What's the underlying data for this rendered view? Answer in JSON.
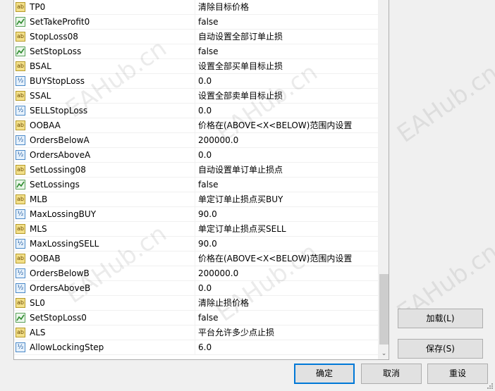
{
  "params": [
    {
      "icon": "ab-icon",
      "name": "TP0",
      "value": "清除目标价格"
    },
    {
      "icon": "bool-icon",
      "name": "SetTakeProfit0",
      "value": "false"
    },
    {
      "icon": "ab-icon",
      "name": "StopLoss08",
      "value": "自动设置全部订单止损"
    },
    {
      "icon": "bool-icon",
      "name": "SetStopLoss",
      "value": "false"
    },
    {
      "icon": "ab-icon",
      "name": "BSAL",
      "value": "设置全部买单目标止损"
    },
    {
      "icon": "value-icon",
      "name": "BUYStopLoss",
      "value": "0.0"
    },
    {
      "icon": "ab-icon",
      "name": "SSAL",
      "value": "设置全部卖单目标止损"
    },
    {
      "icon": "value-icon",
      "name": "SELLStopLoss",
      "value": "0.0"
    },
    {
      "icon": "ab-icon",
      "name": "OOBAA",
      "value": "价格在(ABOVE<X<BELOW)范围内设置"
    },
    {
      "icon": "value-icon",
      "name": "OrdersBelowA",
      "value": "200000.0"
    },
    {
      "icon": "value-icon",
      "name": "OrdersAboveA",
      "value": "0.0"
    },
    {
      "icon": "ab-icon",
      "name": "SetLossing08",
      "value": "自动设置单订单止损点"
    },
    {
      "icon": "bool-icon",
      "name": "SetLossings",
      "value": "false"
    },
    {
      "icon": "ab-icon",
      "name": "MLB",
      "value": "单定订单止损点买BUY"
    },
    {
      "icon": "value-icon",
      "name": "MaxLossingBUY",
      "value": "90.0"
    },
    {
      "icon": "ab-icon",
      "name": "MLS",
      "value": "单定订单止损点买SELL"
    },
    {
      "icon": "value-icon",
      "name": "MaxLossingSELL",
      "value": "90.0"
    },
    {
      "icon": "ab-icon",
      "name": "OOBAB",
      "value": "价格在(ABOVE<X<BELOW)范围内设置"
    },
    {
      "icon": "value-icon",
      "name": "OrdersBelowB",
      "value": "200000.0"
    },
    {
      "icon": "value-icon",
      "name": "OrdersAboveB",
      "value": "0.0"
    },
    {
      "icon": "ab-icon",
      "name": "SL0",
      "value": "清除止损价格"
    },
    {
      "icon": "bool-icon",
      "name": "SetStopLoss0",
      "value": "false"
    },
    {
      "icon": "ab-icon",
      "name": "ALS",
      "value": "平台允许多少点止损"
    },
    {
      "icon": "value-icon",
      "name": "AllowLockingStep",
      "value": "6.0"
    }
  ],
  "buttons": {
    "load": "加载(L)",
    "save": "保存(S)",
    "ok": "确定",
    "cancel": "取消",
    "reset": "重设"
  },
  "watermark": "EAHub.cn",
  "scroll_down_glyph": "⌄"
}
